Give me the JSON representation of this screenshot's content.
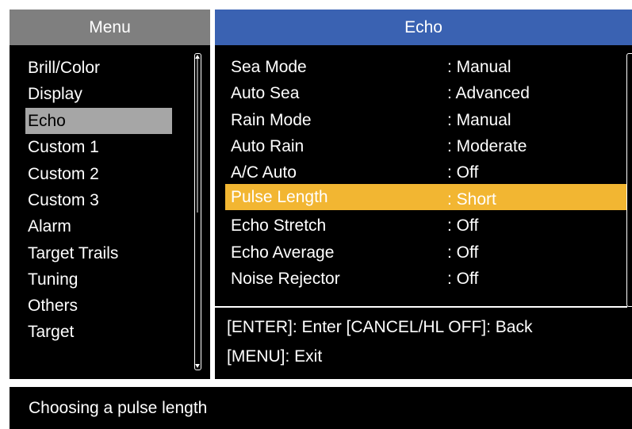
{
  "menu": {
    "title": "Menu",
    "items": [
      "Brill/Color",
      "Display",
      "Echo",
      "Custom 1",
      "Custom 2",
      "Custom 3",
      "Alarm",
      "Target Trails",
      "Tuning",
      "Others",
      "Target"
    ],
    "selected_label": "Echo"
  },
  "echo": {
    "title": "Echo",
    "settings": [
      {
        "name": "Sea Mode",
        "value": ": Manual"
      },
      {
        "name": "Auto Sea",
        "value": ": Advanced"
      },
      {
        "name": "Rain Mode",
        "value": ": Manual"
      },
      {
        "name": "Auto Rain",
        "value": ": Moderate"
      },
      {
        "name": "A/C Auto",
        "value": ": Off"
      },
      {
        "name": "Pulse Length",
        "value": ": Short"
      },
      {
        "name": "Echo Stretch",
        "value": ": Off"
      },
      {
        "name": "Echo Average",
        "value": ": Off"
      },
      {
        "name": "Noise Rejector",
        "value": ": Off"
      }
    ],
    "highlighted_setting": "Pulse Length",
    "help_line_1": "[ENTER]: Enter [CANCEL/HL OFF]: Back",
    "help_line_2": "[MENU]: Exit"
  },
  "caption": "Choosing a pulse length",
  "colors": {
    "menu_header": "#7f7f7f",
    "echo_header": "#3a62b2",
    "highlight": "#f2b632",
    "menu_selected": "#a6a6a6"
  }
}
